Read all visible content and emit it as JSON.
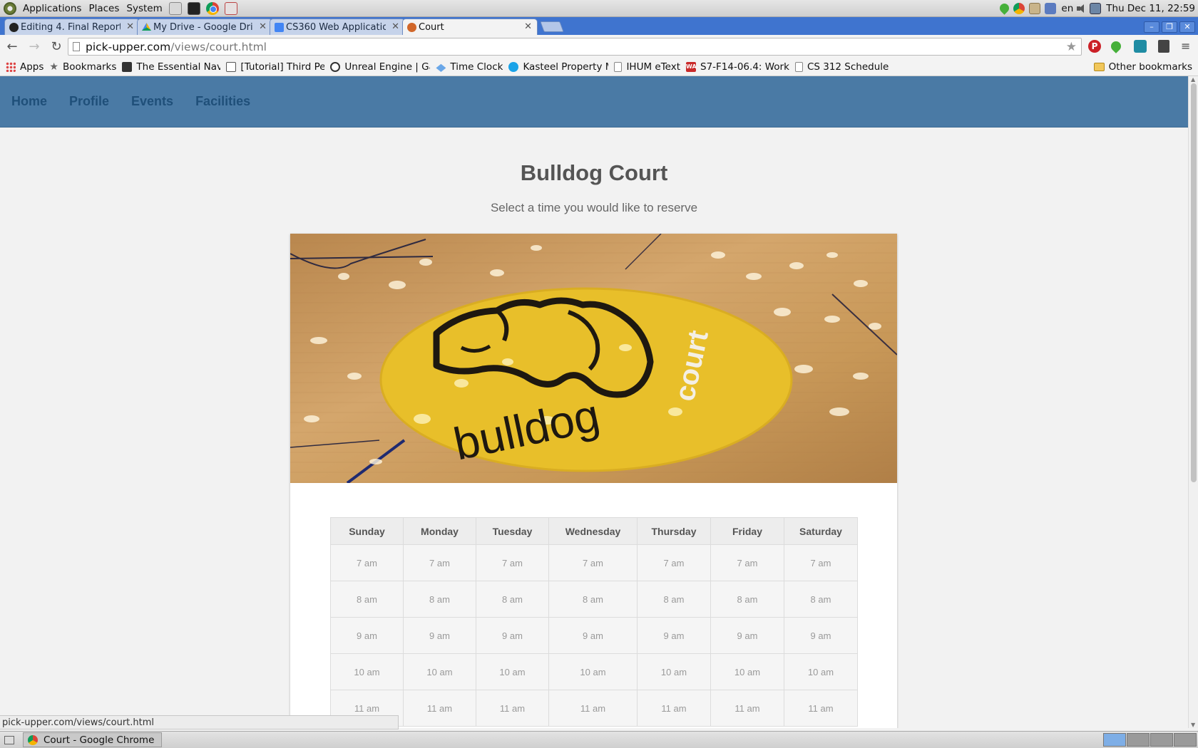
{
  "gnome_panel": {
    "menus": [
      "Applications",
      "Places",
      "System"
    ],
    "language": "en",
    "clock": "Thu Dec 11, 22:59"
  },
  "browser": {
    "tabs": [
      {
        "title": "Editing 4. Final Report",
        "favicon": "github-icon"
      },
      {
        "title": "My Drive - Google Dri",
        "favicon": "google-drive-icon"
      },
      {
        "title": "CS360 Web Applicatio",
        "favicon": "google-docs-icon"
      },
      {
        "title": "Court",
        "favicon": "basketball-icon",
        "active": true
      }
    ],
    "url": {
      "host": "pick-upper.com",
      "path": "/views/court.html"
    },
    "bookmarks": [
      {
        "label": "Apps",
        "icon": "apps-grid-icon"
      },
      {
        "label": "Bookmarks",
        "icon": "star-icon"
      },
      {
        "label": "The Essential Navy",
        "icon": "site-icon"
      },
      {
        "label": "[Tutorial] Third Per",
        "icon": "epic-icon"
      },
      {
        "label": "Unreal Engine | Ga",
        "icon": "unreal-icon"
      },
      {
        "label": "Time Clock",
        "icon": "time-clock-icon"
      },
      {
        "label": "Kasteel Property M",
        "icon": "kasteel-icon"
      },
      {
        "label": "IHUM eText",
        "icon": "page-icon"
      },
      {
        "label": "S7-F14-06.4: Work",
        "icon": "wa-icon"
      },
      {
        "label": "CS 312 Schedule",
        "icon": "page-icon"
      }
    ],
    "other_bookmarks": "Other bookmarks",
    "status_url": "pick-upper.com/views/court.html"
  },
  "site": {
    "nav": [
      "Home",
      "Profile",
      "Events",
      "Facilities"
    ],
    "title": "Bulldog Court",
    "subtitle": "Select a time you would like to reserve",
    "image_logo_text": {
      "word1": "bulldog",
      "word2": "court"
    },
    "schedule": {
      "days": [
        "Sunday",
        "Monday",
        "Tuesday",
        "Wednesday",
        "Thursday",
        "Friday",
        "Saturday"
      ],
      "times": [
        "7 am",
        "8 am",
        "9 am",
        "10 am",
        "11 am"
      ]
    }
  },
  "taskbar": {
    "window_title": "Court - Google Chrome"
  },
  "colors": {
    "site_nav_bg": "#4a7aa5",
    "site_nav_link": "#1f4f79",
    "chrome_frame": "#3f74cf",
    "court_yellow": "#e8bf2a"
  }
}
